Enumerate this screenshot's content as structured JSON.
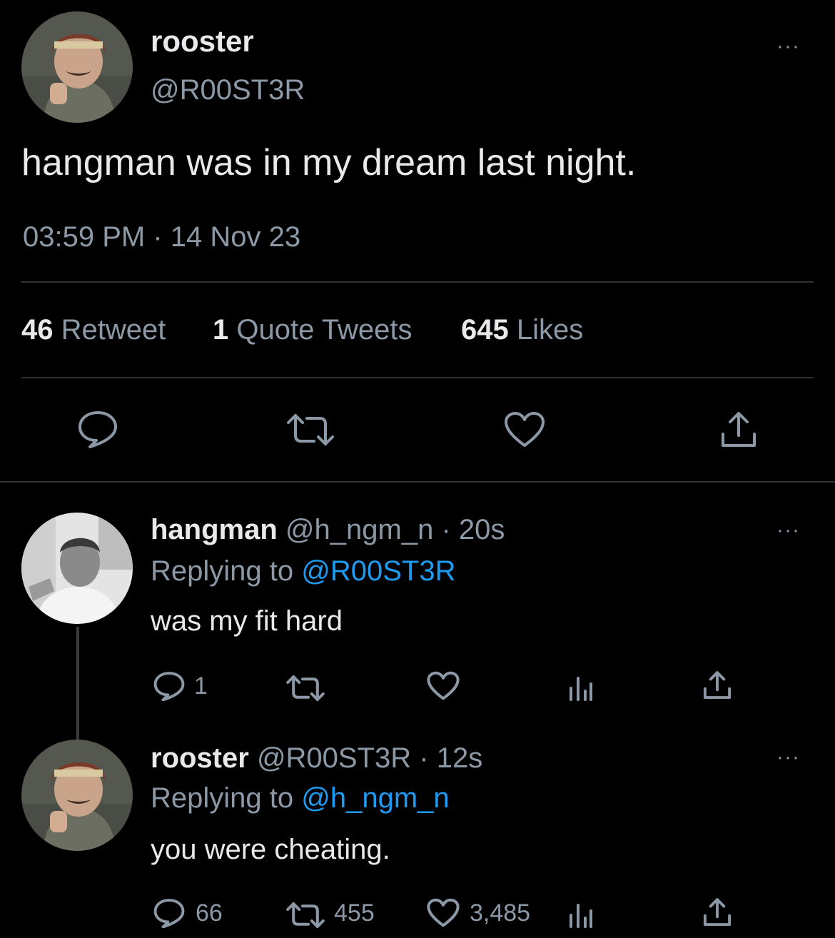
{
  "main_tweet": {
    "display_name": "rooster",
    "handle": "@R00ST3R",
    "text": "hangman was in my dream last night.",
    "timestamp": "03:59 PM · 14 Nov 23",
    "stats": {
      "retweets_count": "46",
      "retweets_label": "Retweet",
      "quotes_count": "1",
      "quotes_label": "Quote Tweets",
      "likes_count": "645",
      "likes_label": "Likes"
    },
    "more_label": "···"
  },
  "replies": [
    {
      "display_name": "hangman",
      "meta": "@h_ngm_n · 20s",
      "replying_prefix": "Replying to",
      "replying_to": "@R00ST3R",
      "text": "was my fit hard",
      "reply_count": "1",
      "retweet_count": "",
      "like_count": "",
      "more_label": "···"
    },
    {
      "display_name": "rooster",
      "meta": "@R00ST3R · 12s",
      "replying_prefix": "Replying to",
      "replying_to": "@h_ngm_n",
      "text": "you were cheating.",
      "reply_count": "66",
      "retweet_count": "455",
      "like_count": "3,485",
      "more_label": "···"
    }
  ],
  "icons": {
    "reply": "reply-icon",
    "retweet": "retweet-icon",
    "like": "heart-icon",
    "views": "analytics-icon",
    "share": "share-icon"
  },
  "colors": {
    "background": "#000000",
    "text": "#e7e9ea",
    "muted": "#8b98a5",
    "link": "#1d9bf0",
    "divider": "#2f3336"
  }
}
